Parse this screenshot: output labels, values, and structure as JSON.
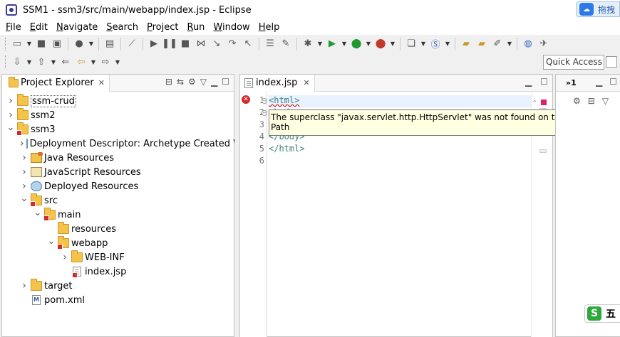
{
  "window": {
    "title": "SSM1 - ssm3/src/main/webapp/index.jsp - Eclipse",
    "badge_text": "拖拽"
  },
  "menu": [
    {
      "key": "F",
      "rest": "ile"
    },
    {
      "key": "E",
      "rest": "dit"
    },
    {
      "key": "N",
      "rest": "avigate"
    },
    {
      "key": "S",
      "rest": "earch",
      "pre": ""
    },
    {
      "key": "P",
      "rest": "roject"
    },
    {
      "key": "R",
      "rest": "un"
    },
    {
      "key": "W",
      "rest": "indow"
    },
    {
      "key": "H",
      "rest": "elp"
    }
  ],
  "quick_access": {
    "placeholder": "Quick Access"
  },
  "project_explorer": {
    "title": "Project Explorer",
    "tree": [
      {
        "label": "ssm-crud",
        "depth": 0,
        "expand": "collapsed",
        "icon": "project",
        "selected": true
      },
      {
        "label": "ssm2",
        "depth": 0,
        "expand": "collapsed",
        "icon": "project"
      },
      {
        "label": "ssm3",
        "depth": 0,
        "expand": "expanded",
        "icon": "project",
        "error": true
      },
      {
        "label": "Deployment Descriptor: Archetype Created Web Application",
        "depth": 1,
        "expand": "collapsed",
        "icon": "descriptor"
      },
      {
        "label": "Java Resources",
        "depth": 1,
        "expand": "collapsed",
        "icon": "java-resources"
      },
      {
        "label": "JavaScript Resources",
        "depth": 1,
        "expand": "collapsed",
        "icon": "js-resources"
      },
      {
        "label": "Deployed Resources",
        "depth": 1,
        "expand": "collapsed",
        "icon": "deployed-resources"
      },
      {
        "label": "src",
        "depth": 1,
        "expand": "expanded",
        "icon": "folder",
        "error": true
      },
      {
        "label": "main",
        "depth": 2,
        "expand": "expanded",
        "icon": "folder",
        "error": true
      },
      {
        "label": "resources",
        "depth": 3,
        "expand": "none",
        "icon": "folder"
      },
      {
        "label": "webapp",
        "depth": 3,
        "expand": "expanded",
        "icon": "folder",
        "error": true
      },
      {
        "label": "WEB-INF",
        "depth": 4,
        "expand": "collapsed",
        "icon": "folder"
      },
      {
        "label": "index.jsp",
        "depth": 4,
        "expand": "none",
        "icon": "file",
        "error": true
      },
      {
        "label": "target",
        "depth": 1,
        "expand": "collapsed",
        "icon": "folder"
      },
      {
        "label": "pom.xml",
        "depth": 1,
        "expand": "none",
        "icon": "xml"
      }
    ]
  },
  "editor": {
    "tab": "index.jsp",
    "line_numbers": [
      "1",
      "2",
      "3",
      "4",
      "5",
      "6"
    ],
    "lines": [
      {
        "text": "<html>",
        "cur": true
      },
      {
        "text": "<body>"
      },
      {
        "text": ""
      },
      {
        "text": "</body>"
      },
      {
        "text": "</html>"
      },
      {
        "text": ""
      }
    ],
    "tooltip": "The superclass \"javax.servlet.http.HttpServlet\" was not found on the Java Build Path"
  },
  "right_panel": {
    "tab_label": "»1"
  },
  "ime": {
    "label": "五"
  }
}
